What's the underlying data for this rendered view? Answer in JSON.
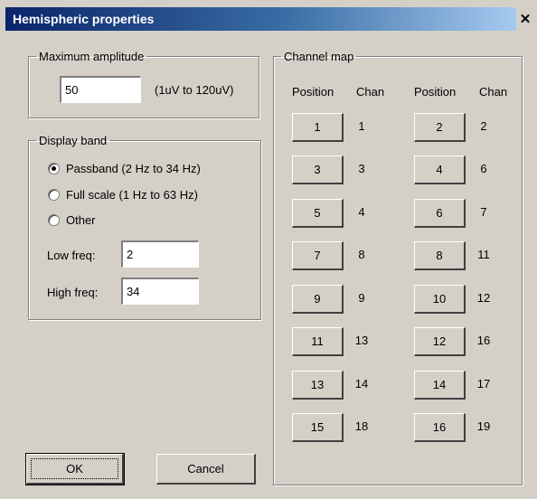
{
  "window": {
    "title": "Hemispheric properties"
  },
  "amplitude": {
    "legend": "Maximum amplitude",
    "value": "50",
    "range_hint": "(1uV to 120uV)"
  },
  "display_band": {
    "legend": "Display band",
    "options": [
      {
        "label": "Passband (2 Hz to 34 Hz)",
        "selected": true
      },
      {
        "label": "Full scale (1 Hz to 63 Hz)",
        "selected": false
      },
      {
        "label": "Other",
        "selected": false
      }
    ],
    "low_label": "Low freq:",
    "low_value": "2",
    "high_label": "High freq:",
    "high_value": "34"
  },
  "channel_map": {
    "legend": "Channel map",
    "headers": {
      "pos1": "Position",
      "chan1": "Chan",
      "pos2": "Position",
      "chan2": "Chan"
    },
    "rows": [
      {
        "left_pos": "1",
        "left_chan": "1",
        "right_pos": "2",
        "right_chan": "2"
      },
      {
        "left_pos": "3",
        "left_chan": "3",
        "right_pos": "4",
        "right_chan": "6"
      },
      {
        "left_pos": "5",
        "left_chan": "4",
        "right_pos": "6",
        "right_chan": "7"
      },
      {
        "left_pos": "7",
        "left_chan": "8",
        "right_pos": "8",
        "right_chan": "11"
      },
      {
        "left_pos": "9",
        "left_chan": "9",
        "right_pos": "10",
        "right_chan": "12"
      },
      {
        "left_pos": "11",
        "left_chan": "13",
        "right_pos": "12",
        "right_chan": "16"
      },
      {
        "left_pos": "13",
        "left_chan": "14",
        "right_pos": "14",
        "right_chan": "17"
      },
      {
        "left_pos": "15",
        "left_chan": "18",
        "right_pos": "16",
        "right_chan": "19"
      }
    ]
  },
  "buttons": {
    "ok": "OK",
    "cancel": "Cancel"
  },
  "colors": {
    "dialog_bg": "#d4d0c8",
    "title_start": "#0a246a",
    "title_end": "#a6caf0"
  }
}
